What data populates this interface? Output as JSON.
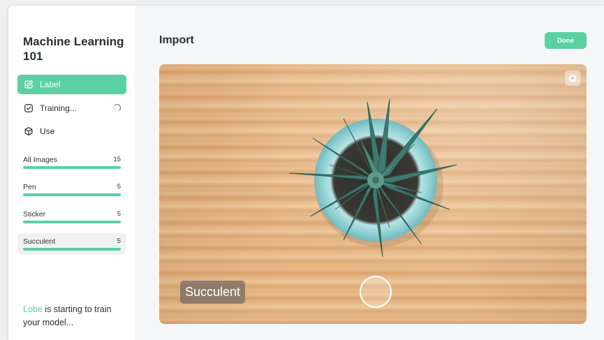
{
  "window": {
    "controls": [
      "close",
      "minimize",
      "zoom"
    ]
  },
  "sidebar": {
    "project_title": "Machine Learning 101",
    "nav": [
      {
        "label": "Label",
        "icon": "edit-icon",
        "active": true
      },
      {
        "label": "Training...",
        "icon": "check-square-icon",
        "busy": true
      },
      {
        "label": "Use",
        "icon": "cube-icon"
      }
    ],
    "labels": [
      {
        "name": "All Images",
        "count": "15",
        "progress": 1.0
      },
      {
        "name": "Pen",
        "count": "5",
        "progress": 1.0
      },
      {
        "name": "Sticker",
        "count": "5",
        "progress": 1.0
      },
      {
        "name": "Succulent",
        "count": "5",
        "progress": 1.0,
        "selected": true
      }
    ],
    "status_brand": "Lobe",
    "status_text": " is starting to train your model..."
  },
  "main": {
    "title": "Import",
    "done_label": "Done",
    "settings_icon": "gear-icon",
    "prediction_label": "Succulent",
    "capture_icon": "capture-circle-icon"
  },
  "colors": {
    "accent": "#5bd0a4",
    "text": "#2b2f33",
    "sidebar_bg": "#ffffff",
    "main_bg": "#f5f6f7"
  }
}
